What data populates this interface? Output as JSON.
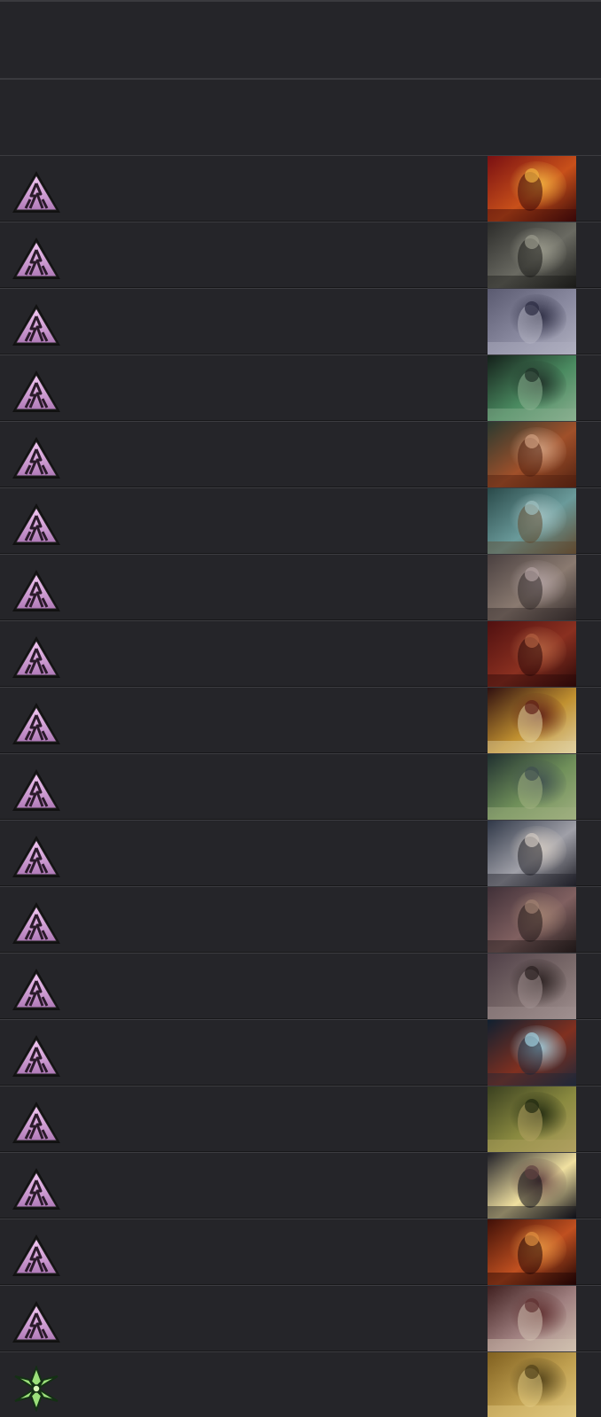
{
  "header_rows": [
    {
      "id": "blank-1"
    },
    {
      "id": "blank-2"
    }
  ],
  "card_rows": [
    {
      "set_icon": "pink-triangle-set-icon",
      "art": {
        "icon": "red-fire-card-art",
        "colors": [
          "#7a1012",
          "#c8501a",
          "#f0b040",
          "#3a0808"
        ]
      }
    },
    {
      "set_icon": "pink-triangle-set-icon",
      "art": {
        "icon": "gray-skeleton-card-art",
        "colors": [
          "#2c2c2a",
          "#6a6a62",
          "#9a9a8c",
          "#1a1a18"
        ]
      }
    },
    {
      "set_icon": "pink-triangle-set-icon",
      "art": {
        "icon": "cloaked-figure-card-art",
        "colors": [
          "#5a5a70",
          "#8a8aa0",
          "#2a2a40",
          "#b0b0c0"
        ]
      }
    },
    {
      "set_icon": "pink-triangle-set-icon",
      "art": {
        "icon": "green-ghouls-card-art",
        "colors": [
          "#14201a",
          "#4a8a60",
          "#203028",
          "#8ab090"
        ]
      }
    },
    {
      "set_icon": "pink-triangle-set-icon",
      "art": {
        "icon": "red-haired-creature-card-art",
        "colors": [
          "#2a3a30",
          "#a0502a",
          "#d0a080",
          "#502010"
        ]
      }
    },
    {
      "set_icon": "pink-triangle-set-icon",
      "art": {
        "icon": "misty-zombies-card-art",
        "colors": [
          "#2a4a4a",
          "#6a9a9a",
          "#a0c0c0",
          "#604a30"
        ]
      }
    },
    {
      "set_icon": "pink-triangle-set-icon",
      "art": {
        "icon": "pale-creatures-card-art",
        "colors": [
          "#4a4040",
          "#8a7a70",
          "#b0a0a0",
          "#302828"
        ]
      }
    },
    {
      "set_icon": "pink-triangle-set-icon",
      "art": {
        "icon": "crimson-ghoul-card-art",
        "colors": [
          "#501010",
          "#8a3020",
          "#b06040",
          "#2a0808"
        ]
      }
    },
    {
      "set_icon": "pink-triangle-set-icon",
      "art": {
        "icon": "lantern-ritual-card-art",
        "colors": [
          "#301010",
          "#c09030",
          "#602018",
          "#e0d0a0"
        ]
      }
    },
    {
      "set_icon": "pink-triangle-set-icon",
      "art": {
        "icon": "green-brute-card-art",
        "colors": [
          "#203030",
          "#70905a",
          "#405050",
          "#a0b080"
        ]
      }
    },
    {
      "set_icon": "pink-triangle-set-icon",
      "art": {
        "icon": "grinning-face-card-art",
        "colors": [
          "#303848",
          "#a0a0a8",
          "#d0c8c0",
          "#202028"
        ]
      }
    },
    {
      "set_icon": "pink-triangle-set-icon",
      "art": {
        "icon": "fallen-body-card-art",
        "colors": [
          "#403038",
          "#806060",
          "#a08070",
          "#201818"
        ]
      }
    },
    {
      "set_icon": "pink-triangle-set-icon",
      "art": {
        "icon": "witch-hunter-card-art",
        "colors": [
          "#504048",
          "#7a6a6a",
          "#2a2020",
          "#a09090"
        ]
      }
    },
    {
      "set_icon": "pink-triangle-set-icon",
      "art": {
        "icon": "hooded-spirits-card-art",
        "colors": [
          "#102030",
          "#803020",
          "#a0d0e0",
          "#202838"
        ]
      }
    },
    {
      "set_icon": "pink-triangle-set-icon",
      "art": {
        "icon": "forest-hag-card-art",
        "colors": [
          "#3a4020",
          "#8a8a40",
          "#202810",
          "#b0a060"
        ]
      }
    },
    {
      "set_icon": "pink-triangle-set-icon",
      "art": {
        "icon": "haunted-house-card-art",
        "colors": [
          "#202028",
          "#f0e0a0",
          "#604040",
          "#101018"
        ]
      }
    },
    {
      "set_icon": "pink-triangle-set-icon",
      "art": {
        "icon": "fiery-demon-card-art",
        "colors": [
          "#401008",
          "#c05020",
          "#e09040",
          "#200404"
        ]
      }
    },
    {
      "set_icon": "pink-triangle-set-icon",
      "art": {
        "icon": "undead-group-card-art",
        "colors": [
          "#402020",
          "#a08080",
          "#603030",
          "#d0c0b0"
        ]
      }
    },
    {
      "set_icon": "green-leaf-set-icon",
      "art": {
        "icon": "golden-idol-card-art",
        "colors": [
          "#806020",
          "#c0a050",
          "#504018",
          "#e0c880"
        ]
      }
    }
  ]
}
